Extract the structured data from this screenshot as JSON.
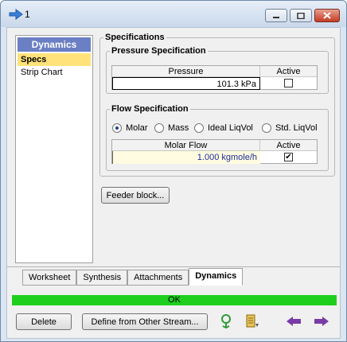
{
  "window": {
    "title": "1"
  },
  "nav": {
    "header": "Dynamics",
    "items": [
      {
        "label": "Specs",
        "selected": true
      },
      {
        "label": "Strip Chart",
        "selected": false
      }
    ]
  },
  "specifications": {
    "title": "Specifications",
    "pressure": {
      "title": "Pressure Specification",
      "col_value": "Pressure",
      "col_active": "Active",
      "value": "101.3 kPa",
      "active": false
    },
    "flow": {
      "title": "Flow Specification",
      "options": [
        "Molar",
        "Mass",
        "Ideal LiqVol",
        "Std. LiqVol"
      ],
      "selected": "Molar",
      "col_value": "Molar Flow",
      "col_active": "Active",
      "value": "1.000 kgmole/h",
      "active": true
    }
  },
  "feeder_button": "Feeder block...",
  "tabs": [
    "Worksheet",
    "Synthesis",
    "Attachments",
    "Dynamics"
  ],
  "active_tab": "Dynamics",
  "status": {
    "text": "OK",
    "color": "#1ecf1e"
  },
  "footer": {
    "delete": "Delete",
    "define": "Define from Other Stream..."
  },
  "colors": {
    "nav_header": "#6a7fc4",
    "selected_item": "#ffe27a",
    "arrow": "#7a3aa8"
  }
}
